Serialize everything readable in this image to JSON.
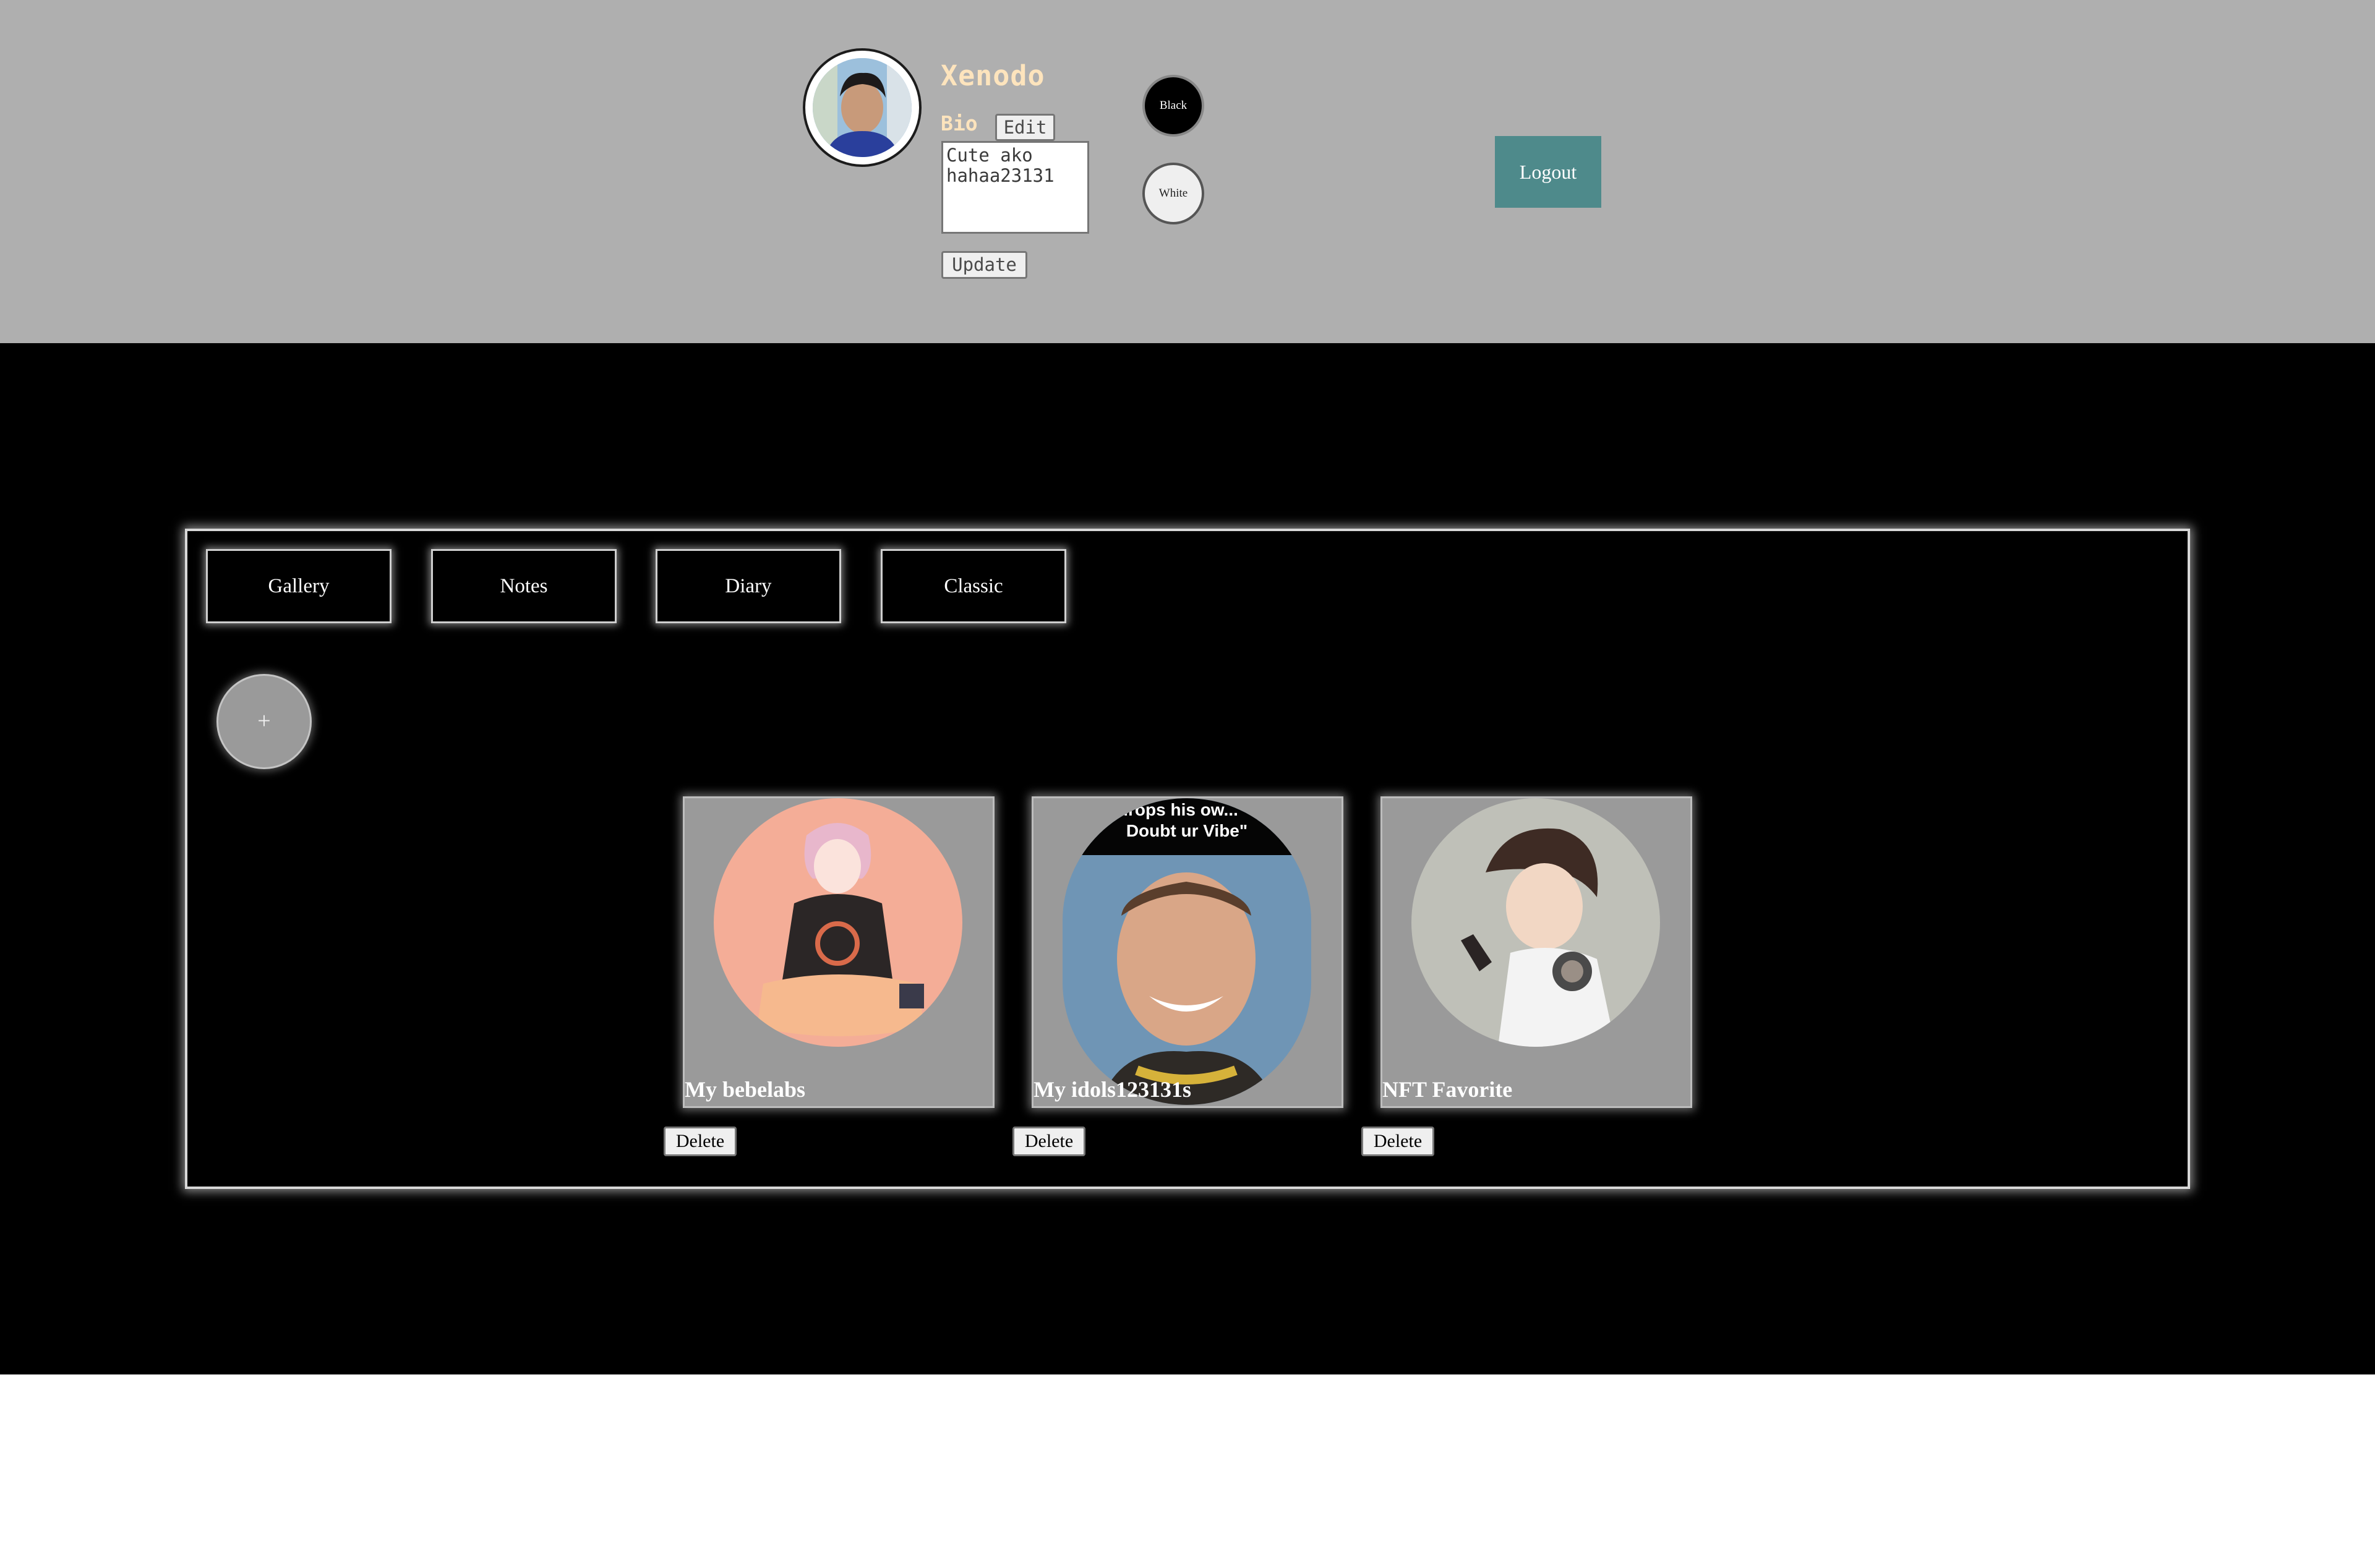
{
  "header": {
    "username": "Xenodo",
    "bio_label": "Bio",
    "edit_label": "Edit",
    "bio_text": "Cute ako hahaa23131",
    "update_label": "Update",
    "theme_black_label": "Black",
    "theme_white_label": "White",
    "logout_label": "Logout"
  },
  "tabs": [
    {
      "label": "Gallery"
    },
    {
      "label": "Notes"
    },
    {
      "label": "Diary"
    },
    {
      "label": "Classic"
    }
  ],
  "add_label": "+",
  "cards": [
    {
      "title": "My bebelabs",
      "delete_label": "Delete"
    },
    {
      "title": "My idols123131s",
      "delete_label": "Delete",
      "image_caption": "...sk drops his ow... \"Don't Doubt ur Vibe\""
    },
    {
      "title": "NFT Favorite",
      "delete_label": "Delete"
    }
  ],
  "colors": {
    "header_bg": "#afafaf",
    "main_bg": "#000000",
    "username": "#fde4bd",
    "logout_bg": "#4e8a8b",
    "card_bg": "#9a9a9a"
  }
}
